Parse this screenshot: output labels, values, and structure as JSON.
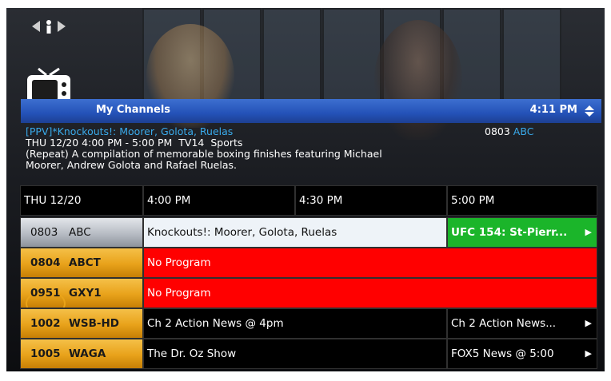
{
  "header": {
    "title": "My Channels",
    "time": "4:11 PM"
  },
  "description": {
    "title": "[PPV]*Knockouts!: Moorer, Golota, Ruelas",
    "channel_number": "0803",
    "channel_name": "ABC",
    "airing": "THU 12/20 4:00 PM - 5:00 PM  TV14  Sports",
    "line1": "(Repeat) A compilation of memorable boxing finishes featuring Michael",
    "line2": "Moorer, Andrew Golota and Rafael Ruelas."
  },
  "grid": {
    "date": "THU 12/20",
    "times": [
      "4:00 PM",
      "4:30 PM",
      "5:00 PM"
    ],
    "rows": [
      {
        "number": "0803",
        "call": "ABC",
        "programs": [
          {
            "title": "Knockouts!: Moorer, Golota, Ruelas"
          },
          {
            "title": "UFC 154: St-Pierr..."
          }
        ]
      },
      {
        "number": "0804",
        "call": "ABCT",
        "programs": [
          {
            "title": "No Program"
          }
        ]
      },
      {
        "number": "0951",
        "call": "GXY1",
        "programs": [
          {
            "title": "No Program"
          }
        ]
      },
      {
        "number": "1002",
        "call": "WSB-HD",
        "programs": [
          {
            "title": "Ch 2 Action News @ 4pm"
          },
          {
            "title": "Ch 2 Action News..."
          }
        ]
      },
      {
        "number": "1005",
        "call": "WAGA",
        "programs": [
          {
            "title": "The Dr. Oz Show"
          },
          {
            "title": "FOX5 News @ 5:00"
          }
        ]
      }
    ]
  },
  "icons": {
    "info": "info-icon",
    "tv": "tv-icon",
    "sort": "sort-up-down-icon",
    "continue": "right-arrow-icon"
  },
  "colors": {
    "header_blue": "#2452b8",
    "title_blue": "#39a9ea",
    "no_program_red": "#ff0000",
    "highlight_green": "#1bb52a",
    "channel_gold": "#e8a21a"
  }
}
